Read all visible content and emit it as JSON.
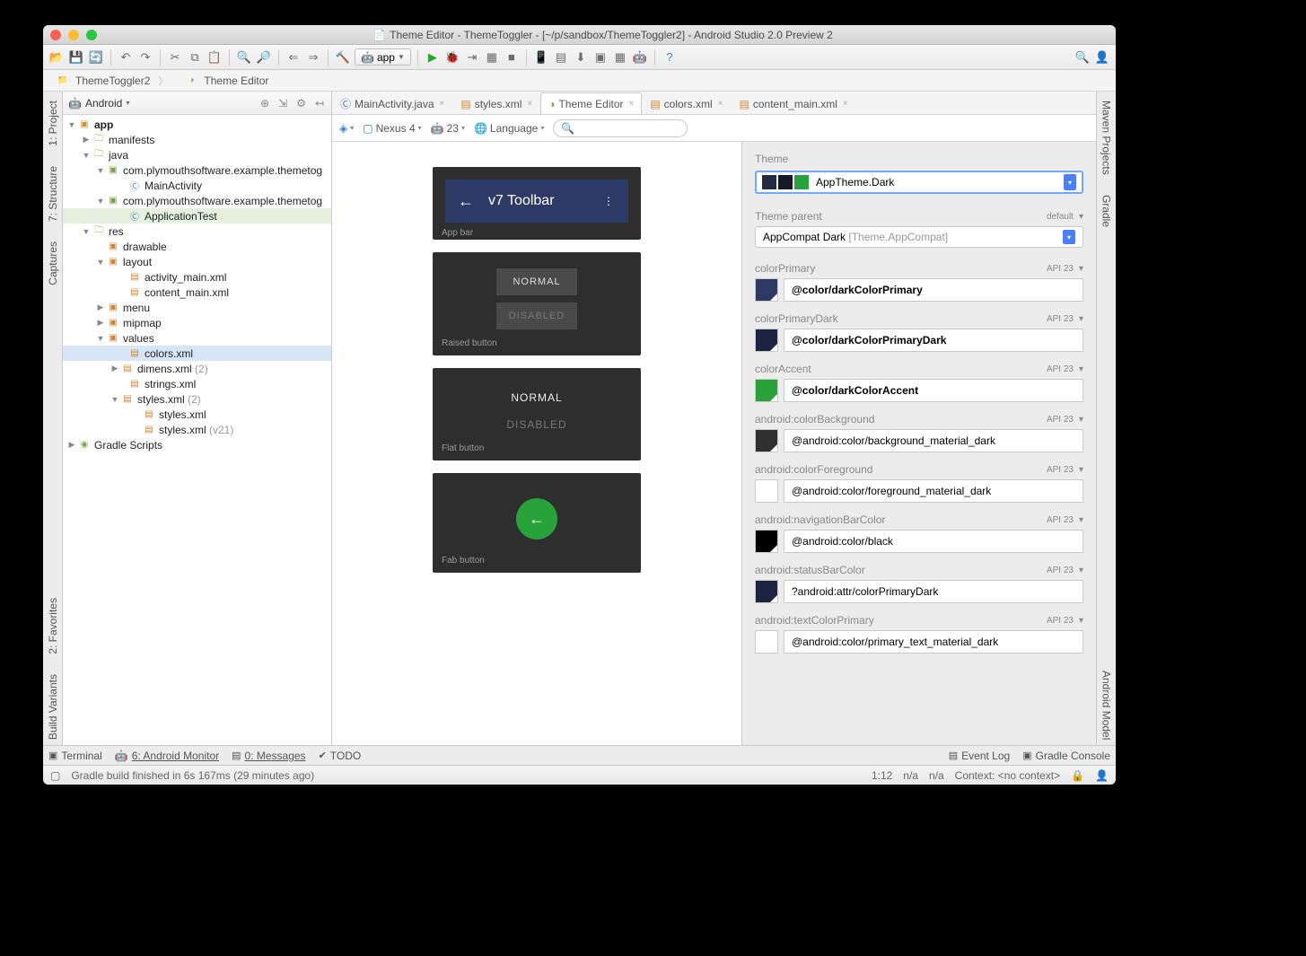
{
  "window": {
    "title": "Theme Editor - ThemeToggler - [~/p/sandbox/ThemeToggler2] - Android Studio 2.0 Preview 2"
  },
  "breadcrumb": [
    "ThemeToggler2",
    "Theme Editor"
  ],
  "runTarget": "app",
  "sidebar": {
    "viewLabel": "Android",
    "tree": {
      "app": "app",
      "manifests": "manifests",
      "java": "java",
      "pkg1": "com.plymouthsoftware.example.themetog",
      "mainActivity": "MainActivity",
      "pkg2": "com.plymouthsoftware.example.themetog",
      "appTest": "ApplicationTest",
      "res": "res",
      "drawable": "drawable",
      "layout": "layout",
      "activity_main": "activity_main.xml",
      "content_main": "content_main.xml",
      "menu": "menu",
      "mipmap": "mipmap",
      "values": "values",
      "colors": "colors.xml",
      "dimens": "dimens.xml",
      "dimens_n": "(2)",
      "strings": "strings.xml",
      "styles": "styles.xml",
      "styles_n": "(2)",
      "styles1": "styles.xml",
      "styles2": "styles.xml",
      "styles2_n": "(v21)",
      "gradle": "Gradle Scripts"
    }
  },
  "leftTabs": {
    "project": "1: Project",
    "structure": "7: Structure",
    "captures": "Captures",
    "favorites": "2: Favorites",
    "build": "Build Variants"
  },
  "rightTabs": {
    "maven": "Maven Projects",
    "gradle": "Gradle",
    "androidModel": "Android Model"
  },
  "editorTabs": [
    {
      "label": "MainActivity.java",
      "kind": "java"
    },
    {
      "label": "styles.xml",
      "kind": "xml"
    },
    {
      "label": "Theme Editor",
      "kind": "theme"
    },
    {
      "label": "colors.xml",
      "kind": "xml"
    },
    {
      "label": "content_main.xml",
      "kind": "xml"
    }
  ],
  "previewBar": {
    "device": "Nexus 4",
    "api": "23",
    "lang": "Language"
  },
  "preview": {
    "toolbarTitle": "v7 Toolbar",
    "appbarLabel": "App bar",
    "normal": "NORMAL",
    "disabled": "DISABLED",
    "raisedLabel": "Raised button",
    "flatLabel": "Flat button",
    "fabLabel": "Fab button"
  },
  "theme": {
    "heading": "Theme",
    "name": "AppTheme.Dark",
    "swatches": [
      "#242b41",
      "#151826",
      "#27a33a"
    ],
    "parentHeading": "Theme parent",
    "parentDefault": "default",
    "parentName": "AppCompat Dark",
    "parentDetail": "[Theme.AppCompat]"
  },
  "attrs": [
    {
      "key": "colorPrimary",
      "val": "@color/darkColorPrimary",
      "api": "API 23",
      "color": "#2d3a66",
      "bold": true
    },
    {
      "key": "colorPrimaryDark",
      "val": "@color/darkColorPrimaryDark",
      "api": "API 23",
      "color": "#1d2442",
      "bold": true
    },
    {
      "key": "colorAccent",
      "val": "@color/darkColorAccent",
      "api": "API 23",
      "color": "#27a33a",
      "bold": true
    },
    {
      "key": "android:colorBackground",
      "val": "@android:color/background_material_dark",
      "api": "API 23",
      "color": "#303030",
      "bold": false
    },
    {
      "key": "android:colorForeground",
      "val": "@android:color/foreground_material_dark",
      "api": "API 23",
      "color": "#ffffff",
      "bold": false
    },
    {
      "key": "android:navigationBarColor",
      "val": "@android:color/black",
      "api": "API 23",
      "color": "#000000",
      "bold": false
    },
    {
      "key": "android:statusBarColor",
      "val": "?android:attr/colorPrimaryDark",
      "api": "API 23",
      "color": "#1d2442",
      "bold": false
    },
    {
      "key": "android:textColorPrimary",
      "val": "@android:color/primary_text_material_dark",
      "api": "API 23",
      "color": "#ffffff",
      "bold": false
    }
  ],
  "bottomTabs": {
    "terminal": "Terminal",
    "monitor": "6: Android Monitor",
    "messages": "0: Messages",
    "todo": "TODO",
    "eventLog": "Event Log",
    "gradleConsole": "Gradle Console"
  },
  "status": {
    "msg": "Gradle build finished in 6s 167ms (29 minutes ago)",
    "pos": "1:12",
    "na1": "n/a",
    "na2": "n/a",
    "ctx": "Context: <no context>"
  }
}
